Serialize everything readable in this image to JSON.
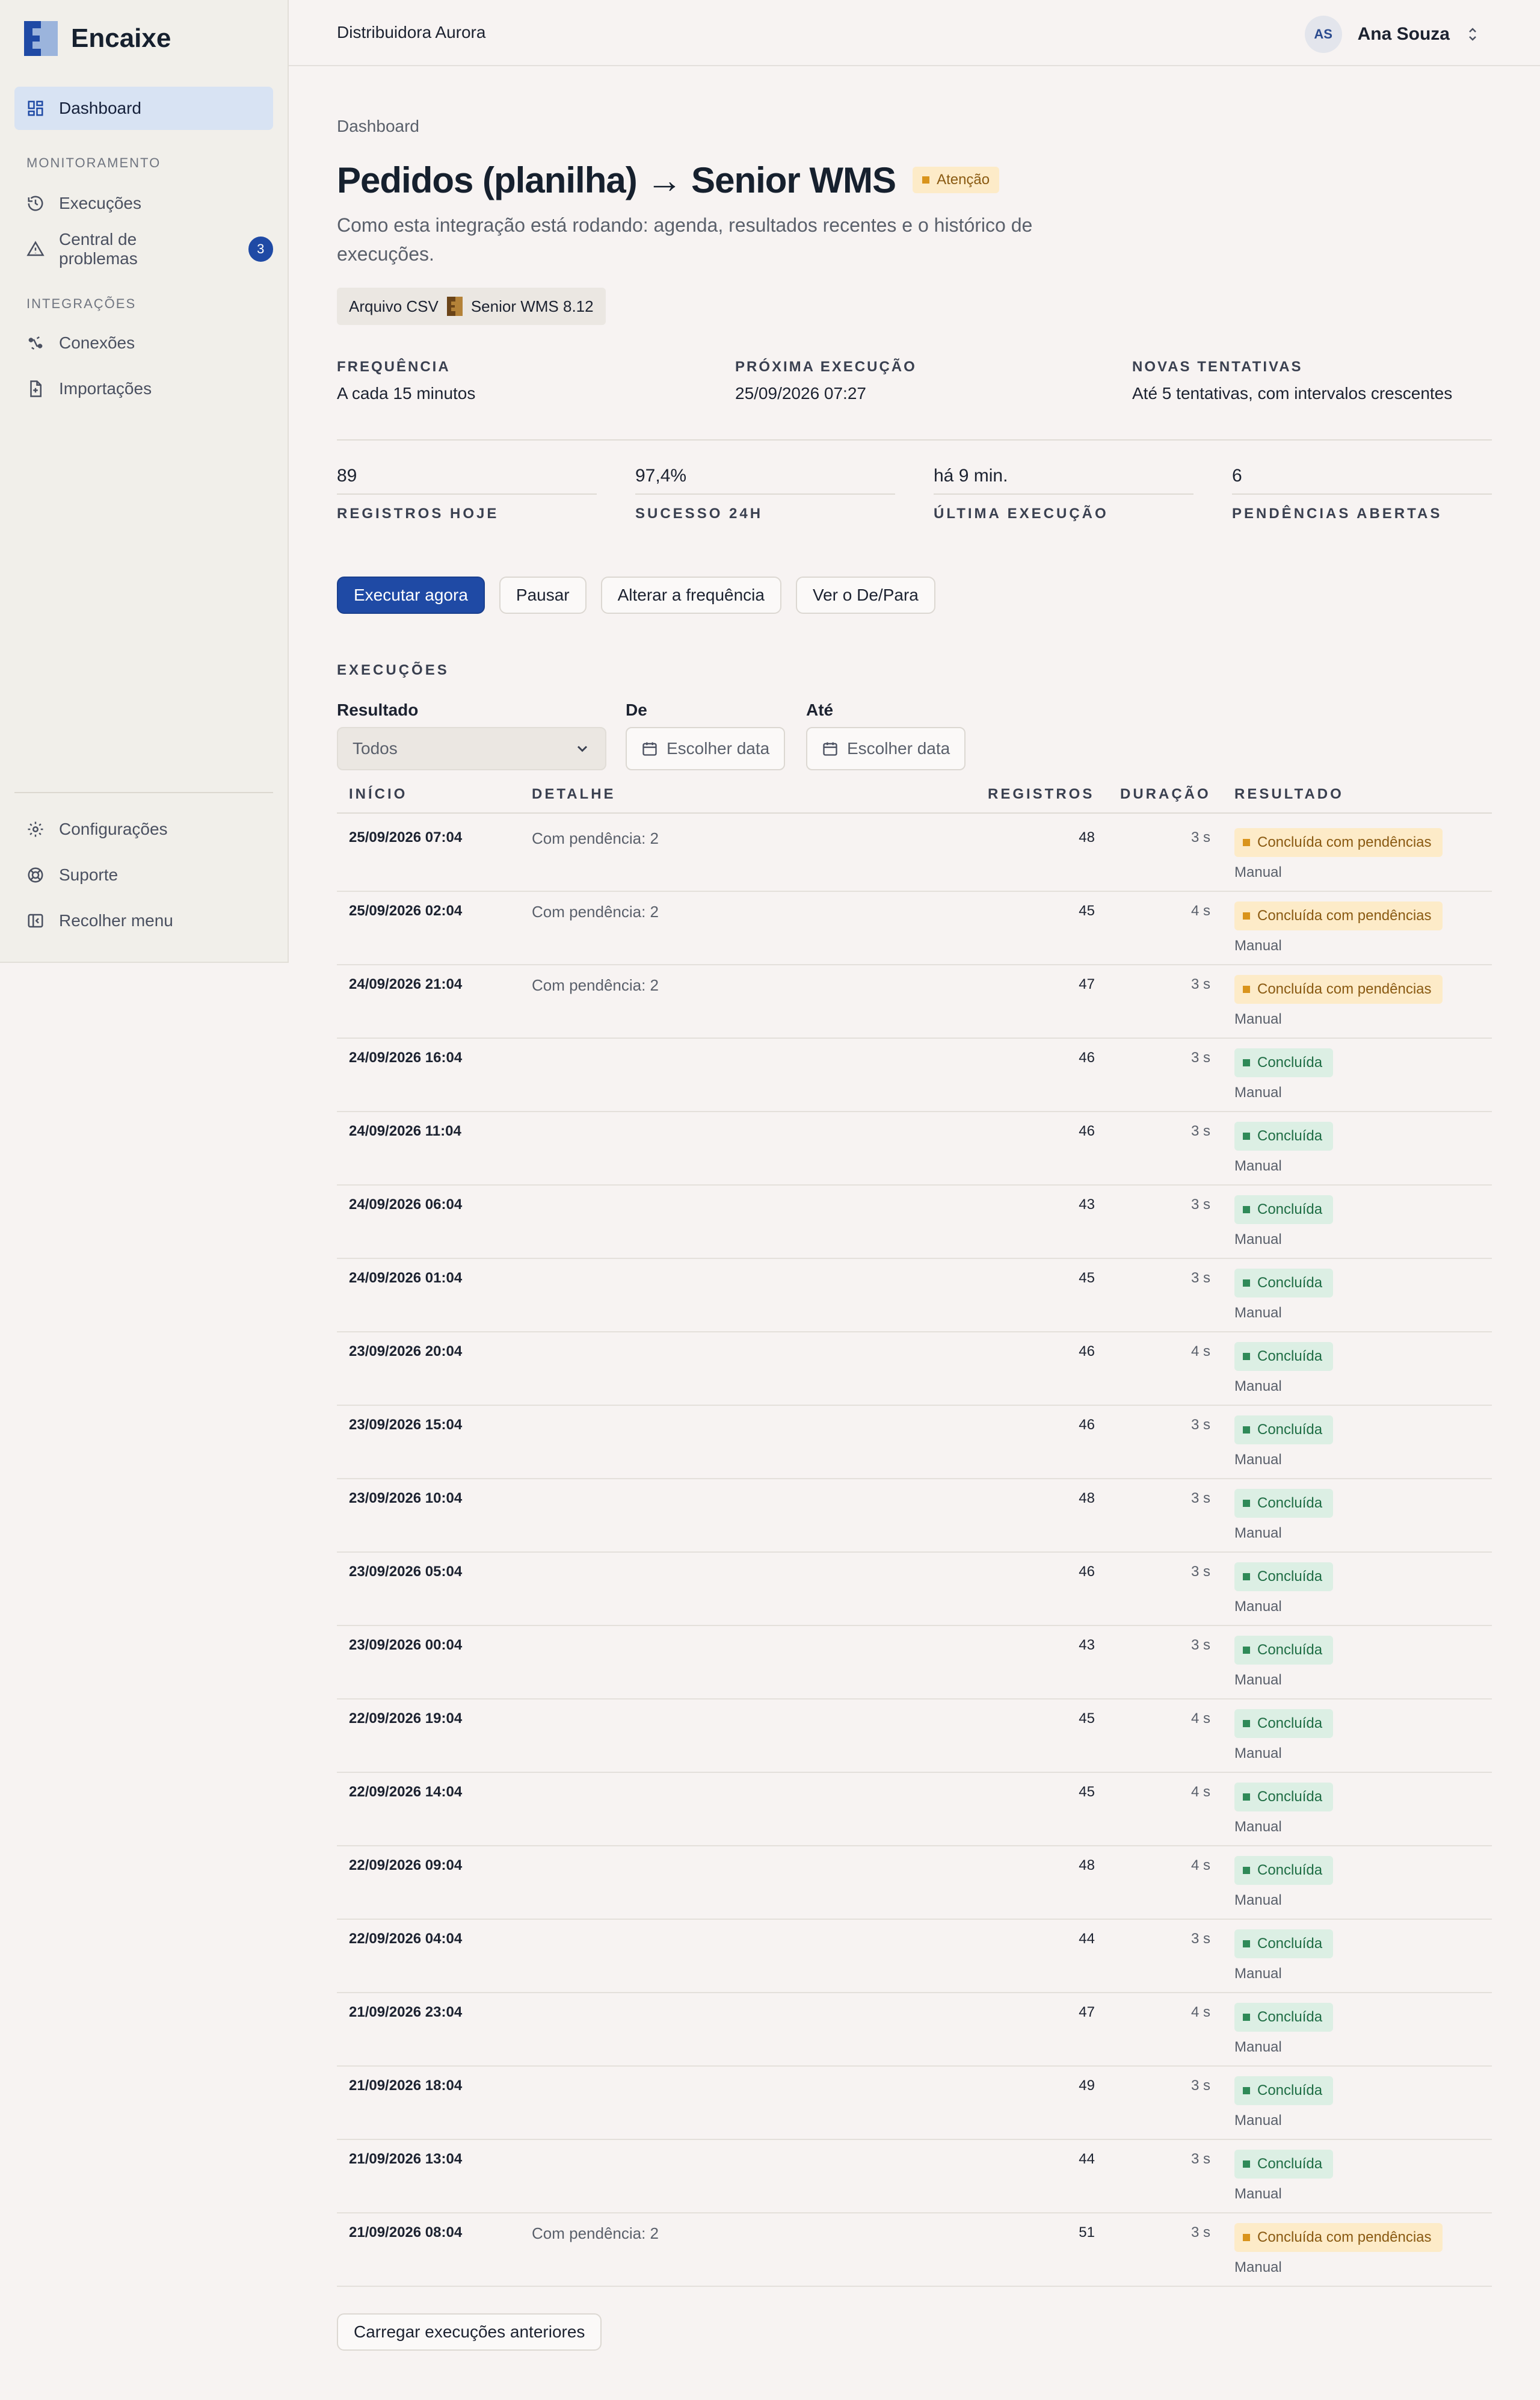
{
  "brand": {
    "name": "Encaixe"
  },
  "sidebar": {
    "dashboard": "Dashboard",
    "section_monitoring": "MONITORAMENTO",
    "executions": "Execuções",
    "problems": "Central de problemas",
    "problems_count": "3",
    "section_integrations": "INTEGRAÇÕES",
    "connections": "Conexões",
    "imports": "Importações",
    "settings": "Configurações",
    "support": "Suporte",
    "collapse": "Recolher menu"
  },
  "topbar": {
    "org": "Distribuidora Aurora",
    "avatar": "AS",
    "user": "Ana Souza"
  },
  "page": {
    "breadcrumb": "Dashboard",
    "title": "Pedidos (planilha) → Senior WMS",
    "status": "Atenção",
    "subtitle": "Como esta integração está rodando: agenda, resultados recentes e o histórico de execuções.",
    "source": "Arquivo CSV",
    "target": "Senior WMS 8.12"
  },
  "meta": {
    "freq_label": "FREQUÊNCIA",
    "freq_value": "A cada 15 minutos",
    "next_label": "PRÓXIMA EXECUÇÃO",
    "next_value": "25/09/2026 07:27",
    "retry_label": "NOVAS TENTATIVAS",
    "retry_value": "Até 5 tentativas, com intervalos crescentes"
  },
  "stats": [
    {
      "value": "89",
      "label": "REGISTROS HOJE"
    },
    {
      "value": "97,4%",
      "label": "SUCESSO 24H"
    },
    {
      "value": "há 9 min.",
      "label": "ÚLTIMA EXECUÇÃO"
    },
    {
      "value": "6",
      "label": "PENDÊNCIAS ABERTAS"
    }
  ],
  "actions": {
    "run": "Executar agora",
    "pause": "Pausar",
    "freq": "Alterar a frequência",
    "mapping": "Ver o De/Para"
  },
  "executions": {
    "section": "EXECUÇÕES",
    "result_label": "Resultado",
    "result_value": "Todos",
    "from_label": "De",
    "to_label": "Até",
    "date_placeholder": "Escolher data",
    "col_start": "INÍCIO",
    "col_detail": "DETALHE",
    "col_records": "REGISTROS",
    "col_duration": "DURAÇÃO",
    "col_result": "RESULTADO",
    "load_more": "Carregar execuções anteriores"
  },
  "colors": {
    "accent": "#1f4aa5",
    "warn_bg": "#fdebc8",
    "warn_fg": "#8a5a12",
    "ok_bg": "#dcefe4",
    "ok_fg": "#1e6d44"
  },
  "rows": [
    {
      "start": "25/09/2026 07:04",
      "detail": "Com pendência: 2",
      "records": "48",
      "duration": "3 s",
      "result": "Concluída com pendências",
      "kind": "pend",
      "mode": "Manual"
    },
    {
      "start": "25/09/2026 02:04",
      "detail": "Com pendência: 2",
      "records": "45",
      "duration": "4 s",
      "result": "Concluída com pendências",
      "kind": "pend",
      "mode": "Manual"
    },
    {
      "start": "24/09/2026 21:04",
      "detail": "Com pendência: 2",
      "records": "47",
      "duration": "3 s",
      "result": "Concluída com pendências",
      "kind": "pend",
      "mode": "Manual"
    },
    {
      "start": "24/09/2026 16:04",
      "detail": "",
      "records": "46",
      "duration": "3 s",
      "result": "Concluída",
      "kind": "ok",
      "mode": "Manual"
    },
    {
      "start": "24/09/2026 11:04",
      "detail": "",
      "records": "46",
      "duration": "3 s",
      "result": "Concluída",
      "kind": "ok",
      "mode": "Manual"
    },
    {
      "start": "24/09/2026 06:04",
      "detail": "",
      "records": "43",
      "duration": "3 s",
      "result": "Concluída",
      "kind": "ok",
      "mode": "Manual"
    },
    {
      "start": "24/09/2026 01:04",
      "detail": "",
      "records": "45",
      "duration": "3 s",
      "result": "Concluída",
      "kind": "ok",
      "mode": "Manual"
    },
    {
      "start": "23/09/2026 20:04",
      "detail": "",
      "records": "46",
      "duration": "4 s",
      "result": "Concluída",
      "kind": "ok",
      "mode": "Manual"
    },
    {
      "start": "23/09/2026 15:04",
      "detail": "",
      "records": "46",
      "duration": "3 s",
      "result": "Concluída",
      "kind": "ok",
      "mode": "Manual"
    },
    {
      "start": "23/09/2026 10:04",
      "detail": "",
      "records": "48",
      "duration": "3 s",
      "result": "Concluída",
      "kind": "ok",
      "mode": "Manual"
    },
    {
      "start": "23/09/2026 05:04",
      "detail": "",
      "records": "46",
      "duration": "3 s",
      "result": "Concluída",
      "kind": "ok",
      "mode": "Manual"
    },
    {
      "start": "23/09/2026 00:04",
      "detail": "",
      "records": "43",
      "duration": "3 s",
      "result": "Concluída",
      "kind": "ok",
      "mode": "Manual"
    },
    {
      "start": "22/09/2026 19:04",
      "detail": "",
      "records": "45",
      "duration": "4 s",
      "result": "Concluída",
      "kind": "ok",
      "mode": "Manual"
    },
    {
      "start": "22/09/2026 14:04",
      "detail": "",
      "records": "45",
      "duration": "4 s",
      "result": "Concluída",
      "kind": "ok",
      "mode": "Manual"
    },
    {
      "start": "22/09/2026 09:04",
      "detail": "",
      "records": "48",
      "duration": "4 s",
      "result": "Concluída",
      "kind": "ok",
      "mode": "Manual"
    },
    {
      "start": "22/09/2026 04:04",
      "detail": "",
      "records": "44",
      "duration": "3 s",
      "result": "Concluída",
      "kind": "ok",
      "mode": "Manual"
    },
    {
      "start": "21/09/2026 23:04",
      "detail": "",
      "records": "47",
      "duration": "4 s",
      "result": "Concluída",
      "kind": "ok",
      "mode": "Manual"
    },
    {
      "start": "21/09/2026 18:04",
      "detail": "",
      "records": "49",
      "duration": "3 s",
      "result": "Concluída",
      "kind": "ok",
      "mode": "Manual"
    },
    {
      "start": "21/09/2026 13:04",
      "detail": "",
      "records": "44",
      "duration": "3 s",
      "result": "Concluída",
      "kind": "ok",
      "mode": "Manual"
    },
    {
      "start": "21/09/2026 08:04",
      "detail": "Com pendência: 2",
      "records": "51",
      "duration": "3 s",
      "result": "Concluída com pendências",
      "kind": "pend",
      "mode": "Manual"
    }
  ]
}
